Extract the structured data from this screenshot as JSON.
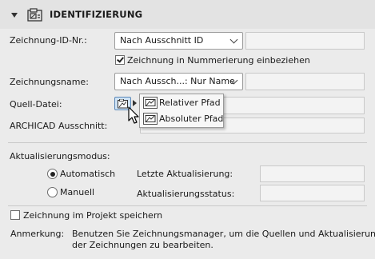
{
  "header": {
    "title": "IDENTIFIZIERUNG"
  },
  "drawing_id": {
    "label": "Zeichnung-ID-Nr.:",
    "select_value": "Nach Ausschnitt ID",
    "field_value": ""
  },
  "numbering": {
    "checkbox_label": "Zeichnung in Nummerierung einbeziehen",
    "checked": true
  },
  "drawing_name": {
    "label": "Zeichnungsname:",
    "select_value": "Nach Aussch...: Nur Name",
    "field_value": ""
  },
  "source_file": {
    "label": "Quell-Datei:",
    "button_icon": "drawing-file-icon"
  },
  "archicad_view": {
    "label": "ARCHICAD Ausschnitt:"
  },
  "popup": {
    "items": [
      {
        "label": "Relativer Pfad",
        "icon": "drawing-file-icon"
      },
      {
        "label": "Absoluter Pfad",
        "icon": "drawing-file-icon"
      }
    ]
  },
  "update": {
    "mode_label": "Aktualisierungsmodus:",
    "options": [
      {
        "label": "Automatisch",
        "selected": true
      },
      {
        "label": "Manuell",
        "selected": false
      }
    ],
    "last_update_label": "Letzte Aktualisierung:",
    "status_label": "Aktualisierungsstatus:"
  },
  "store": {
    "checkbox_label": "Zeichnung im Projekt speichern",
    "checked": false
  },
  "remark": {
    "label": "Anmerkung:",
    "line1": "Benutzen Sie Zeichnungsmanager, um die Quellen und Aktualisierung",
    "line2": "der Zeichnungen zu bearbeiten."
  }
}
